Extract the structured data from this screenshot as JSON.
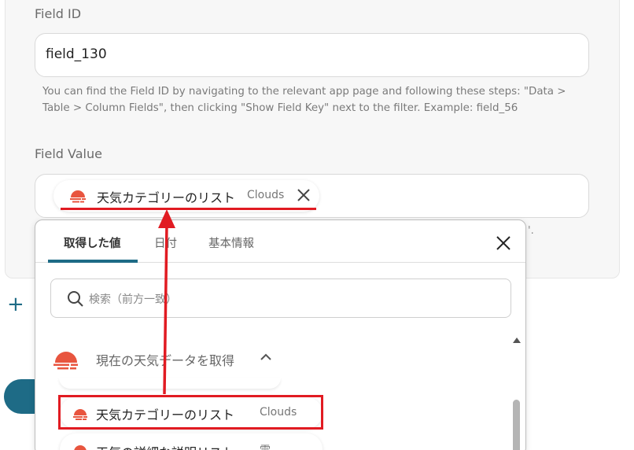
{
  "field_id": {
    "label": "Field ID",
    "value": "field_130",
    "help": "You can find the Field ID by navigating to the relevant app page and following these steps: \"Data > Table > Column Fields\", then clicking \"Show Field Key\" next to the filter. Example: field_56"
  },
  "field_value": {
    "label": "Field Value",
    "chip": {
      "label": "天気カテゴリーのリスト",
      "sub": "Clouds",
      "icon": "weather-cloud-icon"
    },
    "trailing": "'."
  },
  "panel": {
    "tabs": [
      {
        "label": "取得した値",
        "active": true
      },
      {
        "label": "日付",
        "active": false
      },
      {
        "label": "基本情報",
        "active": false
      }
    ],
    "search_placeholder": "検索（前方一致）",
    "group": {
      "label": "現在の天気データを取得",
      "icon": "weather-cloud-icon"
    },
    "items": [
      {
        "label": "天気カテゴリーのリスト",
        "sub": "Clouds"
      },
      {
        "label": "天気の詳細な説明リスト",
        "sub": "雲"
      }
    ]
  },
  "colors": {
    "accent": "#1e6b86",
    "highlight": "#e11b22",
    "icon": "#e8553f"
  }
}
